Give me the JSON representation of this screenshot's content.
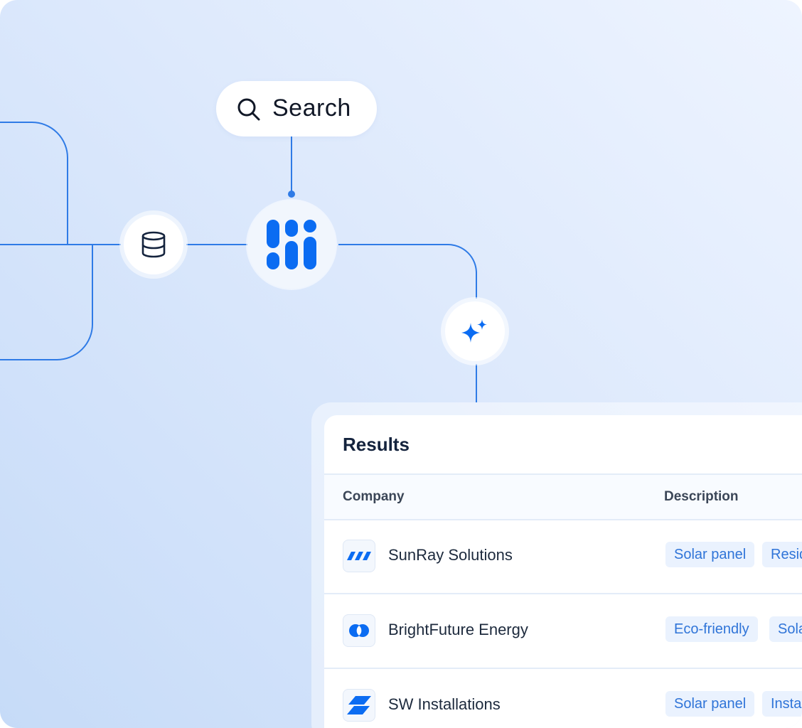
{
  "search": {
    "label": "Search"
  },
  "results": {
    "title": "Results",
    "columns": {
      "company": "Company",
      "description": "Description"
    },
    "rows": [
      {
        "company": "SunRay Solutions",
        "logo": "sunray-stripes-logo",
        "tags": [
          "Solar panel",
          "Resid"
        ]
      },
      {
        "company": "BrightFuture Energy",
        "logo": "brightfuture-circles-logo",
        "tags": [
          "Eco-friendly",
          "Sola"
        ]
      },
      {
        "company": "SW Installations",
        "logo": "sw-parallelogram-logo",
        "tags": [
          "Solar panel",
          "Insta"
        ]
      }
    ]
  },
  "colors": {
    "accent": "#0b6cf2",
    "line": "#2f7be6",
    "text": "#14233d",
    "tag_bg": "#eaf2fe",
    "tag_text": "#2f74d8"
  }
}
